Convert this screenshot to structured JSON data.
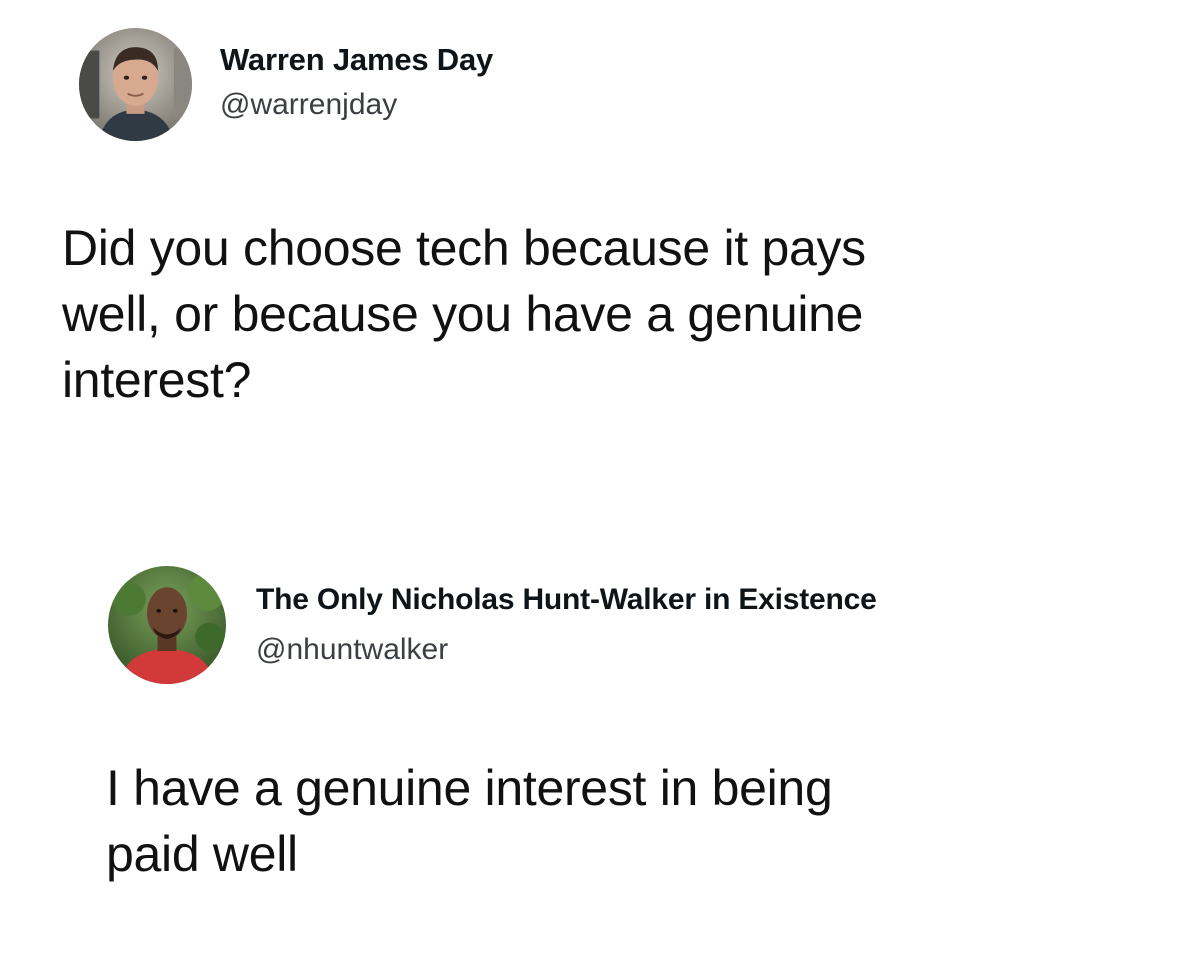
{
  "tweets": [
    {
      "display_name": "Warren James Day",
      "handle": "@warrenjday",
      "text_lines": [
        "Did you choose tech because it pays",
        "well, or because you have a genuine",
        "interest?"
      ]
    },
    {
      "display_name": "The Only Nicholas Hunt-Walker in Existence",
      "handle": "@nhuntwalker",
      "text_lines": [
        "I have a genuine interest in being",
        "paid well"
      ]
    }
  ]
}
